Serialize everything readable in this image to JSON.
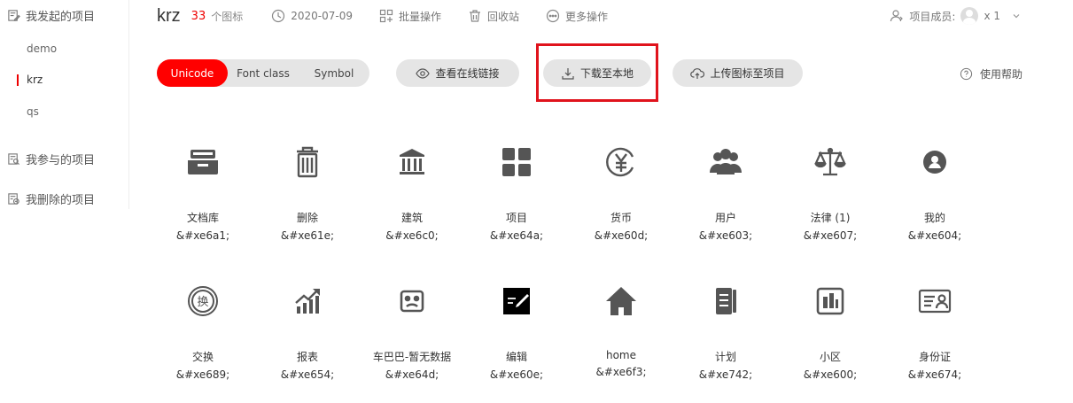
{
  "sidebar": {
    "sections": [
      {
        "label": "我发起的项目",
        "icon": "edit-doc-icon"
      },
      {
        "label": "我参与的项目",
        "icon": "search-doc-icon"
      },
      {
        "label": "我删除的项目",
        "icon": "delete-doc-icon"
      }
    ],
    "items": [
      {
        "label": "demo"
      },
      {
        "label": "krz",
        "active": true
      },
      {
        "label": "qs"
      }
    ]
  },
  "header": {
    "project": "krz",
    "count": "33",
    "count_unit": "个图标",
    "date": "2020-07-09",
    "batch": "批量操作",
    "recycle": "回收站",
    "more": "更多操作",
    "members_label": "项目成员:",
    "members_count": "x 1"
  },
  "toolbar": {
    "tabs": [
      "Unicode",
      "Font class",
      "Symbol"
    ],
    "active_tab": "Unicode",
    "view_link": "查看在线链接",
    "download": "下载至本地",
    "upload": "上传图标至项目",
    "help": "使用帮助"
  },
  "accent_color": "#ff0000",
  "icons": [
    {
      "name": "文档库",
      "code": "&#xe6a1;",
      "icon": "archive-icon"
    },
    {
      "name": "删除",
      "code": "&#xe61e;",
      "icon": "trash-icon"
    },
    {
      "name": "建筑",
      "code": "&#xe6c0;",
      "icon": "building-icon"
    },
    {
      "name": "项目",
      "code": "&#xe64a;",
      "icon": "grid-icon"
    },
    {
      "name": "货币",
      "code": "&#xe60d;",
      "icon": "yen-icon"
    },
    {
      "name": "用户",
      "code": "&#xe603;",
      "icon": "users-icon"
    },
    {
      "name": "法律 (1)",
      "code": "&#xe607;",
      "icon": "scales-icon"
    },
    {
      "name": "我的",
      "code": "&#xe604;",
      "icon": "user-circle-icon"
    },
    {
      "name": "交换",
      "code": "&#xe689;",
      "icon": "exchange-icon"
    },
    {
      "name": "报表",
      "code": "&#xe654;",
      "icon": "chart-icon"
    },
    {
      "name": "车巴巴-暂无数据",
      "code": "&#xe64d;",
      "icon": "sad-face-icon"
    },
    {
      "name": "编辑",
      "code": "&#xe60e;",
      "icon": "edit-icon"
    },
    {
      "name": "home",
      "code": "&#xe6f3;",
      "icon": "home-icon"
    },
    {
      "name": "计划",
      "code": "&#xe742;",
      "icon": "notebook-icon"
    },
    {
      "name": "小区",
      "code": "&#xe600;",
      "icon": "community-icon"
    },
    {
      "name": "身份证",
      "code": "&#xe674;",
      "icon": "id-card-icon"
    }
  ]
}
